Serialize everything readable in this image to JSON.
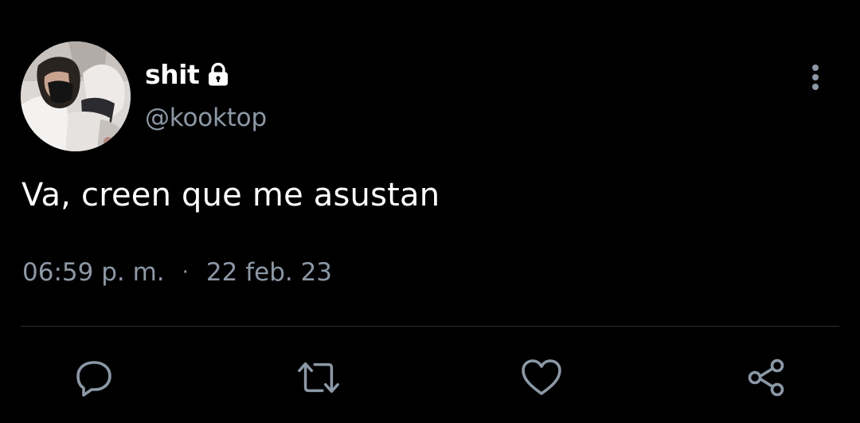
{
  "author": {
    "display_name": "shit",
    "handle": "@kooktop",
    "protected_icon": "lock-icon",
    "avatar": "profile-photo"
  },
  "tweet": {
    "text": "Va, creen que me asustan",
    "time": "06:59 p. m.",
    "separator": "·",
    "date": "22 feb. 23"
  },
  "actions": {
    "reply": "reply-icon",
    "retweet": "retweet-icon",
    "like": "heart-icon",
    "share": "share-icon",
    "more": "more-vertical-icon"
  },
  "colors": {
    "background": "#000000",
    "primary_text": "#ffffff",
    "secondary_text": "#8b98a5",
    "divider": "#2f3336"
  }
}
